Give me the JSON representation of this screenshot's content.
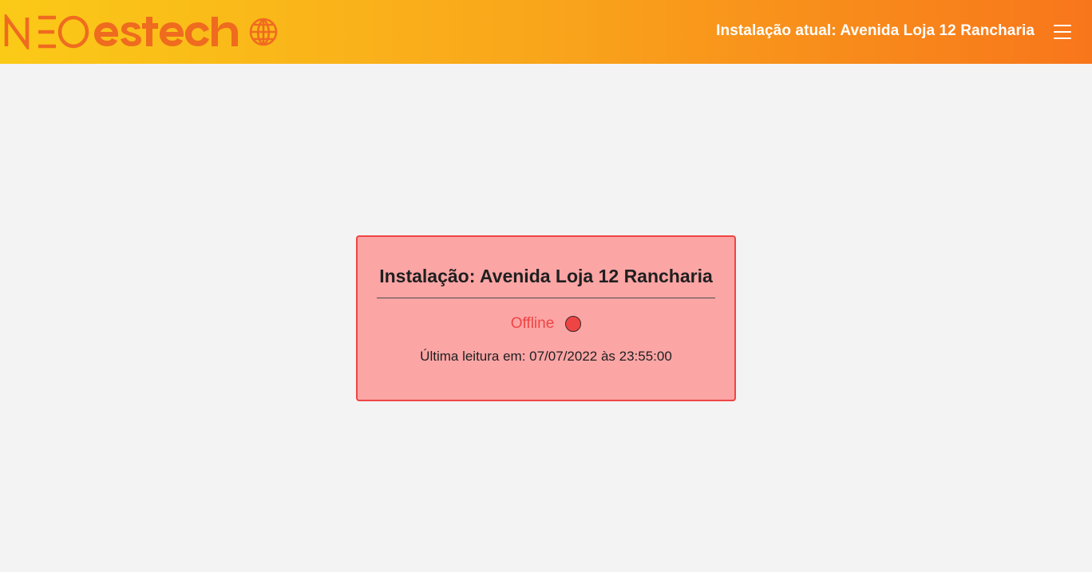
{
  "header": {
    "logo": {
      "brand_part1": "NEO",
      "brand_part2": "estech",
      "icon": "globe-grid-icon"
    },
    "current_installation": "Instalação atual: Avenida Loja 12 Rancharia",
    "menu_icon": "hamburger-menu-icon"
  },
  "card": {
    "title": "Instalação: Avenida Loja 12 Rancharia",
    "status_label": "Offline",
    "status_color": "#ef4444",
    "last_reading": "Última leitura em: 07/07/2022 às 23:55:00"
  },
  "colors": {
    "header_gradient_start": "#fbca17",
    "header_gradient_end": "#f8761b",
    "brand_orange": "#ef6b1f",
    "card_background": "#fca5a5",
    "card_border": "#ef4444",
    "page_background": "#f3f3f3"
  }
}
